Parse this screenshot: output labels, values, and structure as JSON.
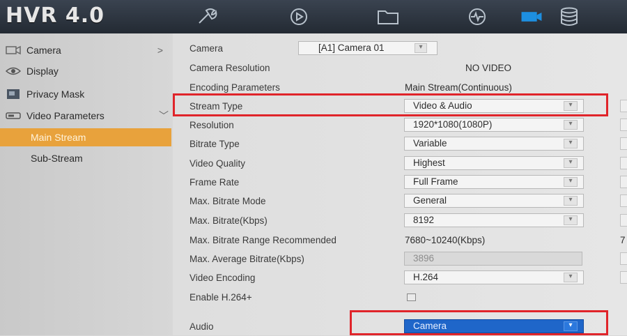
{
  "app": {
    "title": "HVR 4.0"
  },
  "toolbar": {
    "icons": [
      "wrench-icon",
      "playback-icon",
      "folder-icon",
      "system-status-icon",
      "camera-icon",
      "storage-icon"
    ],
    "active_color": "#1d8fe0"
  },
  "sidebar": {
    "items": [
      {
        "label": "Camera",
        "icon": "camera-icon",
        "arrow": ">"
      },
      {
        "label": "Display",
        "icon": "eye-icon"
      },
      {
        "label": "Privacy Mask",
        "icon": "privacy-mask-icon"
      },
      {
        "label": "Video Parameters",
        "icon": "video-icon",
        "arrow": "﹀"
      }
    ],
    "subitems": [
      {
        "label": "Main Stream",
        "active": true
      },
      {
        "label": "Sub-Stream",
        "active": false
      }
    ],
    "active_color": "#e8a23c"
  },
  "form": {
    "camera": {
      "label": "Camera",
      "value": "[A1] Camera 01"
    },
    "rows": [
      {
        "label": "Camera Resolution",
        "value": "NO VIDEO"
      },
      {
        "label": "Encoding Parameters",
        "value": "Main Stream(Continuous)"
      },
      {
        "label": "Stream Type",
        "value": "Video & Audio"
      },
      {
        "label": "Resolution",
        "value": "1920*1080(1080P)"
      },
      {
        "label": "Bitrate Type",
        "value": "Variable"
      },
      {
        "label": "Video Quality",
        "value": "Highest"
      },
      {
        "label": "Frame Rate",
        "value": "Full Frame"
      },
      {
        "label": "Max. Bitrate Mode",
        "value": "General"
      },
      {
        "label": "Max. Bitrate(Kbps)",
        "value": "8192"
      },
      {
        "label": "Max. Bitrate Range Recommended",
        "value": "7680~10240(Kbps)"
      },
      {
        "label": "Max. Average Bitrate(Kbps)",
        "value": "3896"
      },
      {
        "label": "Video Encoding",
        "value": "H.264"
      },
      {
        "label": "Enable H.264+",
        "checked": false
      },
      {
        "label": "Audio",
        "value": "Camera"
      }
    ],
    "side_digit": "7"
  },
  "colors": {
    "highlight": "#e0242a",
    "focus": "#1f66c9"
  }
}
